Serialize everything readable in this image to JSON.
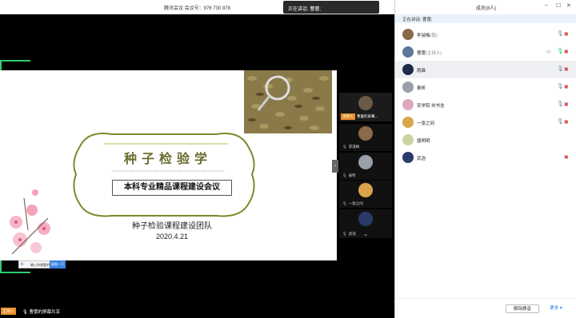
{
  "meeting": {
    "title": "腾讯会议  会议号：976 730 878",
    "speaking_toast": "正在讲话: 曹蕾;"
  },
  "slide": {
    "title": "种子检验学",
    "subtitle": "本科专业精品课程建设会议",
    "team": "种子检验课程建设团队",
    "date": "2020.4.21"
  },
  "input_bar": {
    "placeholder": "输入你想要的",
    "button": "复制一下"
  },
  "video_strip": {
    "host_tag": "主持人",
    "host_share": "曹蕾的屏幕...",
    "tiles": [
      {
        "name": "李淑梅"
      },
      {
        "name": "泰昕"
      },
      {
        "name": "一张之间"
      },
      {
        "name": "武浩"
      }
    ]
  },
  "bottom_bar": {
    "host_tag": "主持人",
    "share_text": "曹蕾的屏幕共享"
  },
  "panel": {
    "title": "成员(8人)",
    "speaking": "正在讲话: 曹蕾;",
    "members": [
      {
        "name": "李淑梅",
        "role": "(我)",
        "color": "#8a6a4a"
      },
      {
        "name": "曹蕾",
        "role": "(主持人)",
        "color": "#5d7a9a"
      },
      {
        "name": "雨霖",
        "role": "",
        "color": "#1e2b4a"
      },
      {
        "name": "泰昕",
        "role": "",
        "color": "#9aa0a8"
      },
      {
        "name": "农学院 刘书含",
        "role": "",
        "color": "#e0a8c0"
      },
      {
        "name": "一张之间",
        "role": "",
        "color": "#d9a44a"
      },
      {
        "name": "唐明明",
        "role": "",
        "color": "#c9d4a0"
      },
      {
        "name": "武浩",
        "role": "",
        "color": "#2a3a6a"
      }
    ],
    "mute_all": "解除静音",
    "more": "更多 ▾"
  },
  "colors": {
    "accent": "#2ecc71",
    "host_tag": "#e8902c",
    "olive": "#6b6b2f"
  }
}
